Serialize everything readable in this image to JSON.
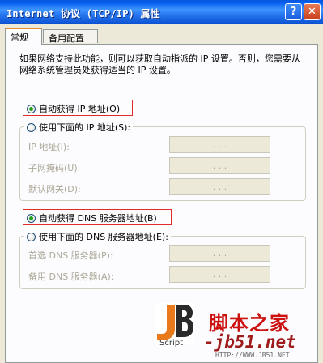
{
  "window": {
    "title": "Internet 协议 (TCP/IP) 属性",
    "help_icon_glyph": "?",
    "close_icon_glyph": "✕"
  },
  "tabs": [
    {
      "label": "常规",
      "active": true
    },
    {
      "label": "备用配置",
      "active": false
    }
  ],
  "description": "如果网络支持此功能，则可以获取自动指派的 IP 设置。否则，您需要从网络系统管理员处获得适当的 IP 设置。",
  "ip": {
    "auto_label": "自动获得 IP 地址(O)",
    "manual_label": "使用下面的 IP 地址(S):",
    "fields": [
      {
        "label": "IP 地址(I):",
        "value": ". . ."
      },
      {
        "label": "子网掩码(U):",
        "value": ". . ."
      },
      {
        "label": "默认网关(D):",
        "value": ". . ."
      }
    ]
  },
  "dns": {
    "auto_label": "自动获得 DNS 服务器地址(B)",
    "manual_label": "使用下面的 DNS 服务器地址(E):",
    "fields": [
      {
        "label": "首选 DNS 服务器(P):",
        "value": ". . ."
      },
      {
        "label": "备用 DNS 服务器(A):",
        "value": ". . ."
      }
    ]
  },
  "watermark": {
    "logo_text": "JB",
    "script": "Script",
    "site_name": "脚本之家",
    "url": "-jb51.net",
    "sub": "HTTP://WWW.JB51.NET"
  },
  "colors": {
    "highlight_box": "#E22A2A",
    "radio_selected": "#21A121",
    "titlebar": "#0A5BD8"
  }
}
